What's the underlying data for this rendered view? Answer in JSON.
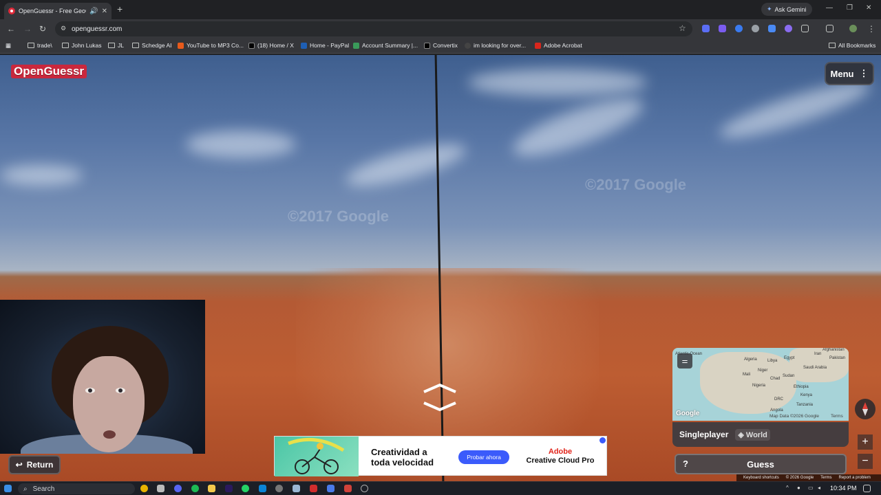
{
  "browser": {
    "tab_title": "OpenGuessr - Free GeoGue",
    "ask_gemini": "Ask Gemini",
    "url": "openguessr.com",
    "bookmarks": [
      "trade\\",
      "John Lukas",
      "JL",
      "Schedge AI",
      "YouTube to MP3 Co...",
      "(18) Home / X",
      "Home - PayPal",
      "Account Summary |...",
      "Convertix",
      "im looking for over...",
      "Adobe Acrobat"
    ],
    "all_bookmarks": "All Bookmarks"
  },
  "game": {
    "logo": "OpenGuessr",
    "menu": "Menu",
    "watermark": "©2017 Google",
    "return": "Return",
    "mode": "Singleplayer",
    "region": "World",
    "guess": "Guess",
    "help": "?"
  },
  "map": {
    "labels": [
      "Atlantic Ocean",
      "Algeria",
      "Libya",
      "Egypt",
      "Iran",
      "Afghanistan",
      "Pakistan",
      "Mali",
      "Niger",
      "Chad",
      "Sudan",
      "Saudi Arabia",
      "Nigeria",
      "Ethiopia",
      "DRC",
      "Kenya",
      "Tanzania",
      "Angola"
    ],
    "attribution": "Map Data ©2026 Google",
    "terms": "Terms",
    "google": "Google"
  },
  "ad": {
    "headline_1": "Creatividad a",
    "headline_2": "toda velocidad",
    "cta": "Probar ahora",
    "brand_1": "Adobe",
    "brand_2": "Creative Cloud Pro"
  },
  "footer": {
    "shortcuts": "Keyboard shortcuts",
    "copyright": "© 2026 Google",
    "terms": "Terms",
    "report": "Report a problem"
  },
  "taskbar": {
    "search": "Search",
    "time": "10:34 PM"
  }
}
